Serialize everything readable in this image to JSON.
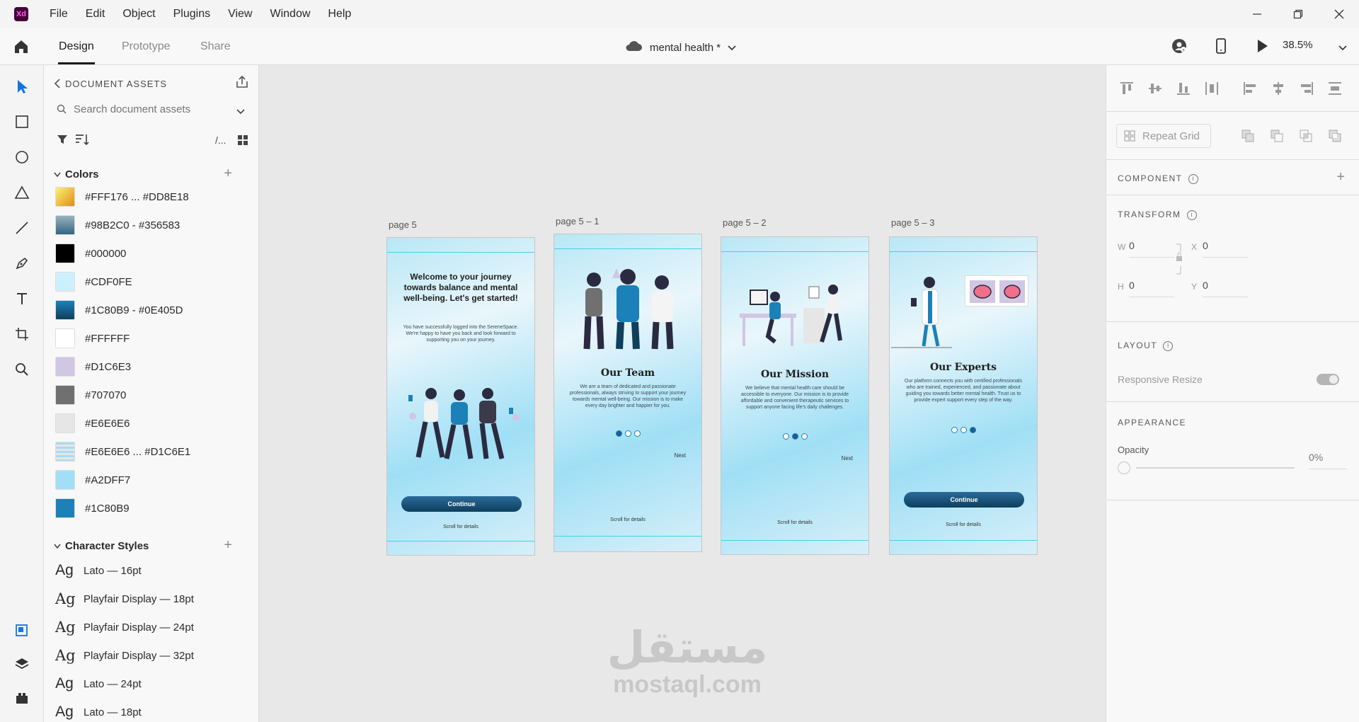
{
  "menubar": {
    "logo_text": "Xd",
    "items": [
      "File",
      "Edit",
      "Object",
      "Plugins",
      "View",
      "Window",
      "Help"
    ]
  },
  "toolbar": {
    "tabs": [
      "Design",
      "Prototype",
      "Share"
    ],
    "doc_title": "mental health *",
    "zoom": "38.5%"
  },
  "assets": {
    "title": "DOCUMENT ASSETS",
    "search_placeholder": "Search document assets",
    "view_toggle_text": "/...",
    "colors_heading": "Colors",
    "colors": [
      {
        "label": "#FFF176 ... #DD8E18",
        "swatch": "linear-gradient(135deg,#fff176,#dd8e18)"
      },
      {
        "label": "#98B2C0 - #356583",
        "swatch": "linear-gradient(#98b2c0,#356583)"
      },
      {
        "label": "#000000",
        "swatch": "#000000"
      },
      {
        "label": "#CDF0FE",
        "swatch": "#cdf0fe"
      },
      {
        "label": "#1C80B9 - #0E405D",
        "swatch": "linear-gradient(#1c80b9,#0e405d)"
      },
      {
        "label": "#FFFFFF",
        "swatch": "#ffffff"
      },
      {
        "label": "#D1C6E3",
        "swatch": "#d1c6e3"
      },
      {
        "label": "#707070",
        "swatch": "#707070"
      },
      {
        "label": "#E6E6E6",
        "swatch": "#e6e6e6"
      },
      {
        "label": "#E6E6E6 ... #D1C6E1",
        "swatch": "repeating-linear-gradient(#a9dcf2 0 3px,#e6e6e6 3px 6px)"
      },
      {
        "label": "#A2DFF7",
        "swatch": "#a2dff7"
      },
      {
        "label": "#1C80B9",
        "swatch": "#1c80b9"
      }
    ],
    "char_heading": "Character Styles",
    "char_styles": [
      {
        "label": "Lato — 16pt",
        "serif": false
      },
      {
        "label": "Playfair Display — 18pt",
        "serif": true
      },
      {
        "label": "Playfair Display — 24pt",
        "serif": true
      },
      {
        "label": "Playfair Display — 32pt",
        "serif": true
      },
      {
        "label": "Lato — 24pt",
        "serif": false
      },
      {
        "label": "Lato — 18pt",
        "serif": false
      }
    ]
  },
  "artboards": [
    {
      "name": "page 5",
      "title": "Welcome to your journey towards balance and mental well-being. Let's get started!",
      "body": "You have successfully logged into the SereneSpace. We're happy to have you back and look forward to supporting you on your journey.",
      "cta": "Continue",
      "footer": "Scroll for details"
    },
    {
      "name": "page 5 – 1",
      "title": "Our Team",
      "body": "We are a team of dedicated and passionate professionals, always striving to support your journey towards mental well-being. Our mission is to make every day brighter and happier for you.",
      "next": "Next",
      "footer": "Scroll for details",
      "dots": [
        true,
        false,
        false
      ]
    },
    {
      "name": "page 5 – 2",
      "title": "Our Mission",
      "body": "We believe that mental health care should be accessible to everyone. Our mission is to provide affordable and convenient therapeutic services to support anyone facing life's daily challenges.",
      "next": "Next",
      "footer": "Scroll for details",
      "dots": [
        false,
        true,
        false
      ]
    },
    {
      "name": "page 5 – 3",
      "title": "Our Experts",
      "body": "Our platform connects you with certified professionals who are trained, experienced, and passionate about guiding you towards better mental health. Trust us to provide expert support every step of the way.",
      "cta": "Continue",
      "footer": "Scroll for details",
      "dots": [
        false,
        false,
        true
      ]
    }
  ],
  "watermark": {
    "arabic": "مستقل",
    "latin": "mostaql.com"
  },
  "props": {
    "repeat_grid": "Repeat Grid",
    "component": "COMPONENT",
    "transform": "TRANSFORM",
    "w_label": "W",
    "w_value": "0",
    "h_label": "H",
    "h_value": "0",
    "x_label": "X",
    "x_value": "0",
    "y_label": "Y",
    "y_value": "0",
    "layout": "LAYOUT",
    "responsive_resize": "Responsive Resize",
    "appearance": "APPEARANCE",
    "opacity_label": "Opacity",
    "opacity_value": "0%"
  },
  "colors": {
    "accent": "#1473e6",
    "brand": "#470137"
  }
}
